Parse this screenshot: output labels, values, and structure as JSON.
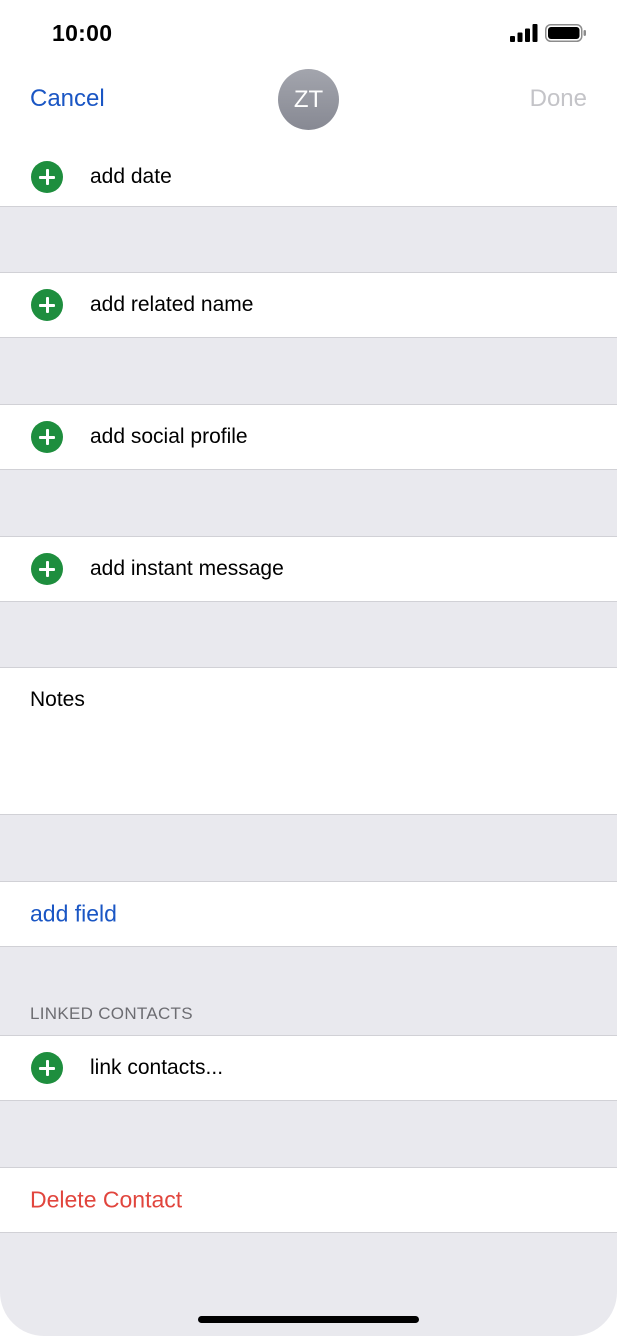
{
  "status_bar": {
    "time": "10:00"
  },
  "nav": {
    "cancel_label": "Cancel",
    "done_label": "Done",
    "avatar_initials": "ZT"
  },
  "rows": {
    "add_date": "add date",
    "add_related_name": "add related name",
    "add_social_profile": "add social profile",
    "add_instant_message": "add instant message"
  },
  "notes": {
    "label": "Notes"
  },
  "add_field_label": "add field",
  "linked_contacts": {
    "header": "LINKED CONTACTS",
    "link_label": "link contacts..."
  },
  "delete_label": "Delete Contact",
  "colors": {
    "accent_blue": "#1a56c4",
    "plus_green": "#1e8e3e",
    "destructive_red": "#e1453d",
    "group_background": "#e9e9ee",
    "done_disabled": "#c4c4c8"
  },
  "icons": [
    "cellular-signal-icon",
    "battery-icon",
    "add-circle-icon"
  ]
}
